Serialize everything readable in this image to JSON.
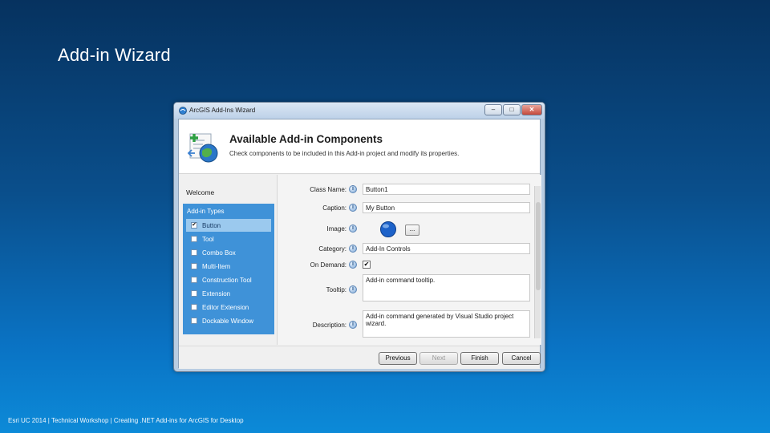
{
  "slide": {
    "title": "Add-in Wizard",
    "footer": "Esri UC 2014 | Technical Workshop | Creating .NET Add-ins for ArcGIS for Desktop"
  },
  "window": {
    "title": "ArcGIS Add-Ins Wizard",
    "min_glyph": "–",
    "max_glyph": "□",
    "close_glyph": "✕"
  },
  "header": {
    "title": "Available Add-in Components",
    "subtitle": "Check components to be included in this Add-in project and modify its properties."
  },
  "nav": {
    "welcome": "Welcome",
    "section": "Add-in Types",
    "items": [
      {
        "label": "Button",
        "checked": "✔"
      },
      {
        "label": "Tool",
        "checked": ""
      },
      {
        "label": "Combo Box",
        "checked": ""
      },
      {
        "label": "Multi-Item",
        "checked": ""
      },
      {
        "label": "Construction Tool",
        "checked": ""
      },
      {
        "label": "Extension",
        "checked": ""
      },
      {
        "label": "Editor Extension",
        "checked": ""
      },
      {
        "label": "Dockable Window",
        "checked": ""
      }
    ]
  },
  "form": {
    "info_glyph": "i",
    "class_name_label": "Class Name:",
    "class_name_value": "Button1",
    "caption_label": "Caption:",
    "caption_value": "My Button",
    "image_label": "Image:",
    "image_button": "...",
    "category_label": "Category:",
    "category_value": "Add-In Controls",
    "on_demand_label": "On Demand:",
    "on_demand_checked": "✔",
    "tooltip_label": "Tooltip:",
    "tooltip_value": "Add-in command tooltip.",
    "description_label": "Description:",
    "description_value": "Add-in command generated by Visual Studio project wizard."
  },
  "buttons": {
    "previous": "Previous",
    "next": "Next",
    "finish": "Finish",
    "cancel": "Cancel"
  }
}
